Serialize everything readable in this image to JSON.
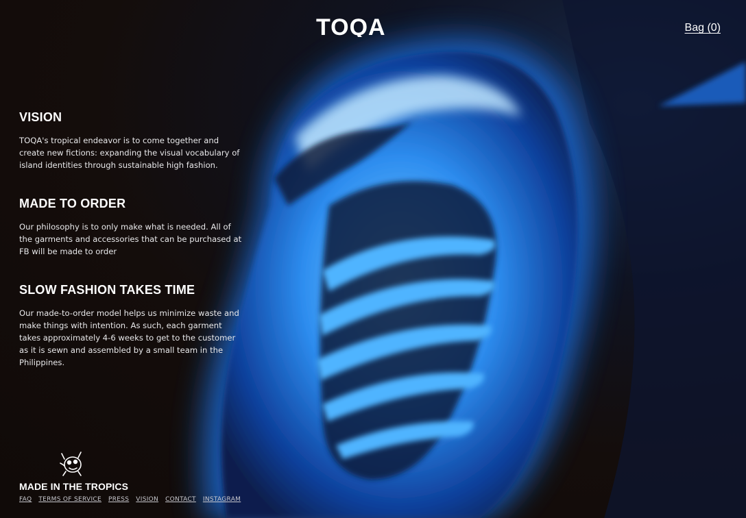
{
  "brand": {
    "logo_text": "TOQA"
  },
  "header": {
    "bag_label": "Bag (0)"
  },
  "sections": [
    {
      "title": "VISION",
      "body": "TOQA's tropical endeavor is to come together and create new fictions: expanding the visual vocabulary of island identities through sustainable high fashion."
    },
    {
      "title": "MADE TO ORDER",
      "body": "Our philosophy is to only make what is needed. All of the garments and accessories that can be purchased at FB will be made to order"
    },
    {
      "title": "SLOW FASHION TAKES TIME",
      "body": "Our made-to-order model helps us minimize waste and make things with intention. As such, each garment takes approximately 4-6 weeks to get to the customer as it is sewn and assembled by a small team in the Philippines."
    }
  ],
  "footer": {
    "title": "MADE IN THE TROPICS",
    "links": [
      "FAQ",
      "TERMS OF SERVICE",
      "PRESS",
      "VISION",
      "CONTACT",
      "INSTAGRAM"
    ]
  },
  "colors": {
    "background": "#120c0a",
    "glow_blue": "#2f9dff",
    "text": "#ffffff"
  },
  "icons": {
    "mascot": "cartoon-creature-icon"
  }
}
